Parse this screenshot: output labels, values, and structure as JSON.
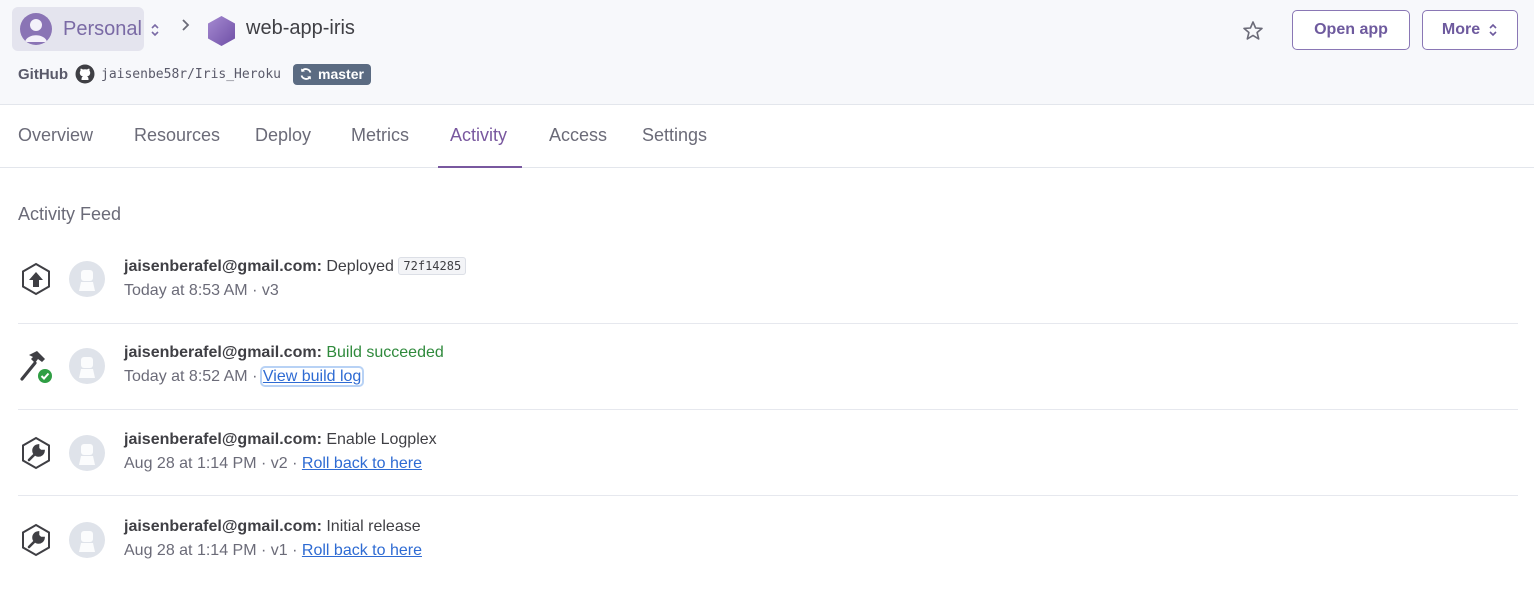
{
  "header": {
    "account_label": "Personal",
    "app_name": "web-app-iris",
    "github_label": "GitHub",
    "repo": "jaisenbe58r/Iris_Heroku",
    "branch": "master",
    "open_app_label": "Open app",
    "more_label": "More"
  },
  "tabs": [
    {
      "label": "Overview"
    },
    {
      "label": "Resources"
    },
    {
      "label": "Deploy"
    },
    {
      "label": "Metrics"
    },
    {
      "label": "Activity",
      "active": true
    },
    {
      "label": "Access"
    },
    {
      "label": "Settings"
    }
  ],
  "feed": {
    "title": "Activity Feed",
    "entries": [
      {
        "icon": "deploy-upload-icon",
        "user": "jaisenberafel@gmail.com:",
        "action": "Deployed",
        "sha": "72f14285",
        "time": "Today at 8:53 AM",
        "sep": "·",
        "version": "v3"
      },
      {
        "icon": "build-hammer-check-icon",
        "user": "jaisenberafel@gmail.com:",
        "action": "Build succeeded",
        "time": "Today at 8:52 AM",
        "sep": "·",
        "link": "View build log"
      },
      {
        "icon": "wrench-icon",
        "user": "jaisenberafel@gmail.com:",
        "action": "Enable Logplex",
        "time": "Aug 28 at 1:14 PM",
        "sep": "·",
        "version": "v2",
        "sep2": "·",
        "link": "Roll back to here"
      },
      {
        "icon": "wrench-icon",
        "user": "jaisenberafel@gmail.com:",
        "action": "Initial release",
        "time": "Aug 28 at 1:14 PM",
        "sep": "·",
        "version": "v1",
        "sep2": "·",
        "link": "Roll back to here"
      }
    ]
  },
  "colors": {
    "accent": "#79589f",
    "success": "#2f8a3c",
    "link": "#2e6bd3",
    "branch_badge": "#5b6b82"
  }
}
